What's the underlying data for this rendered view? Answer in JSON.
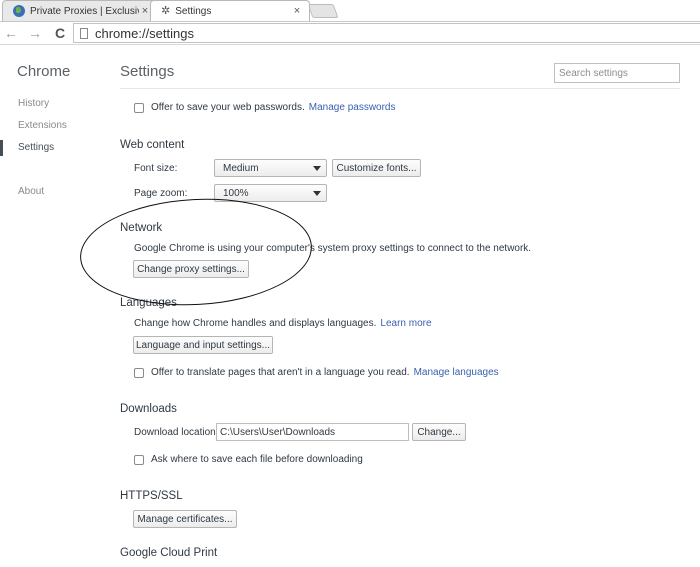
{
  "tabs": [
    {
      "title": "Private Proxies | Exclusive",
      "close": "×",
      "icon": "globe-icon"
    },
    {
      "title": "Settings",
      "close": "×",
      "icon": "gear-icon"
    }
  ],
  "toolbar": {
    "back": "←",
    "forward": "→",
    "reload": "C",
    "url": "chrome://settings"
  },
  "sidebar": {
    "title": "Chrome",
    "items": [
      {
        "label": "History"
      },
      {
        "label": "Extensions"
      },
      {
        "label": "Settings",
        "selected": true
      },
      {
        "label": "About"
      }
    ]
  },
  "header": {
    "title": "Settings",
    "search_placeholder": "Search settings"
  },
  "passwords": {
    "offer_label": "Offer to save your web passwords.",
    "manage_link": "Manage passwords"
  },
  "web_content": {
    "heading": "Web content",
    "font_size_label": "Font size:",
    "font_size_value": "Medium",
    "customize_fonts": "Customize fonts...",
    "page_zoom_label": "Page zoom:",
    "page_zoom_value": "100%"
  },
  "network": {
    "heading": "Network",
    "description": "Google Chrome is using your computer's system proxy settings to connect to the network.",
    "proxy_button": "Change proxy settings..."
  },
  "languages": {
    "heading": "Languages",
    "description": "Change how Chrome handles and displays languages.",
    "learn_more": "Learn more",
    "input_button": "Language and input settings...",
    "translate_label": "Offer to translate pages that aren't in a language you read.",
    "manage_languages": "Manage languages"
  },
  "downloads": {
    "heading": "Downloads",
    "location_label": "Download location:",
    "location_value": "C:\\Users\\User\\Downloads",
    "change_button": "Change...",
    "ask_label": "Ask where to save each file before downloading"
  },
  "https": {
    "heading": "HTTPS/SSL",
    "certs_button": "Manage certificates..."
  },
  "cloud_print": {
    "heading": "Google Cloud Print"
  }
}
